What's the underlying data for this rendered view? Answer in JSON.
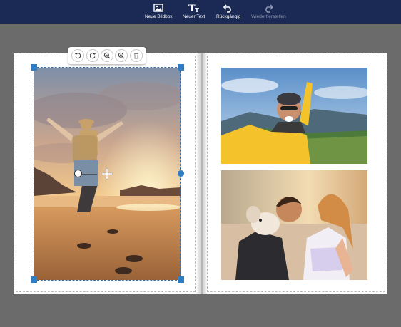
{
  "toolbar": {
    "items": [
      {
        "label": "Neue Bildbox",
        "icon": "image-box-icon",
        "enabled": true
      },
      {
        "label": "Neuer Text",
        "icon": "text-icon",
        "enabled": true
      },
      {
        "label": "Rückgängig",
        "icon": "undo-icon",
        "enabled": true
      },
      {
        "label": "Wiederherstellen",
        "icon": "redo-icon",
        "enabled": false
      }
    ]
  },
  "image_toolbar": {
    "buttons": [
      {
        "icon": "rotate-left-icon"
      },
      {
        "icon": "rotate-right-icon"
      },
      {
        "icon": "zoom-out-icon"
      },
      {
        "icon": "zoom-in-icon"
      },
      {
        "icon": "trash-icon"
      }
    ]
  },
  "colors": {
    "toolbar_bg": "#1b2a55",
    "workspace_bg": "#6b6b6b",
    "handle": "#2f7ec4"
  },
  "photos": [
    {
      "description_icon": "beach-photo",
      "selected": true
    },
    {
      "description_icon": "selfie-photo",
      "selected": false
    },
    {
      "description_icon": "couple-photo",
      "selected": false
    }
  ]
}
